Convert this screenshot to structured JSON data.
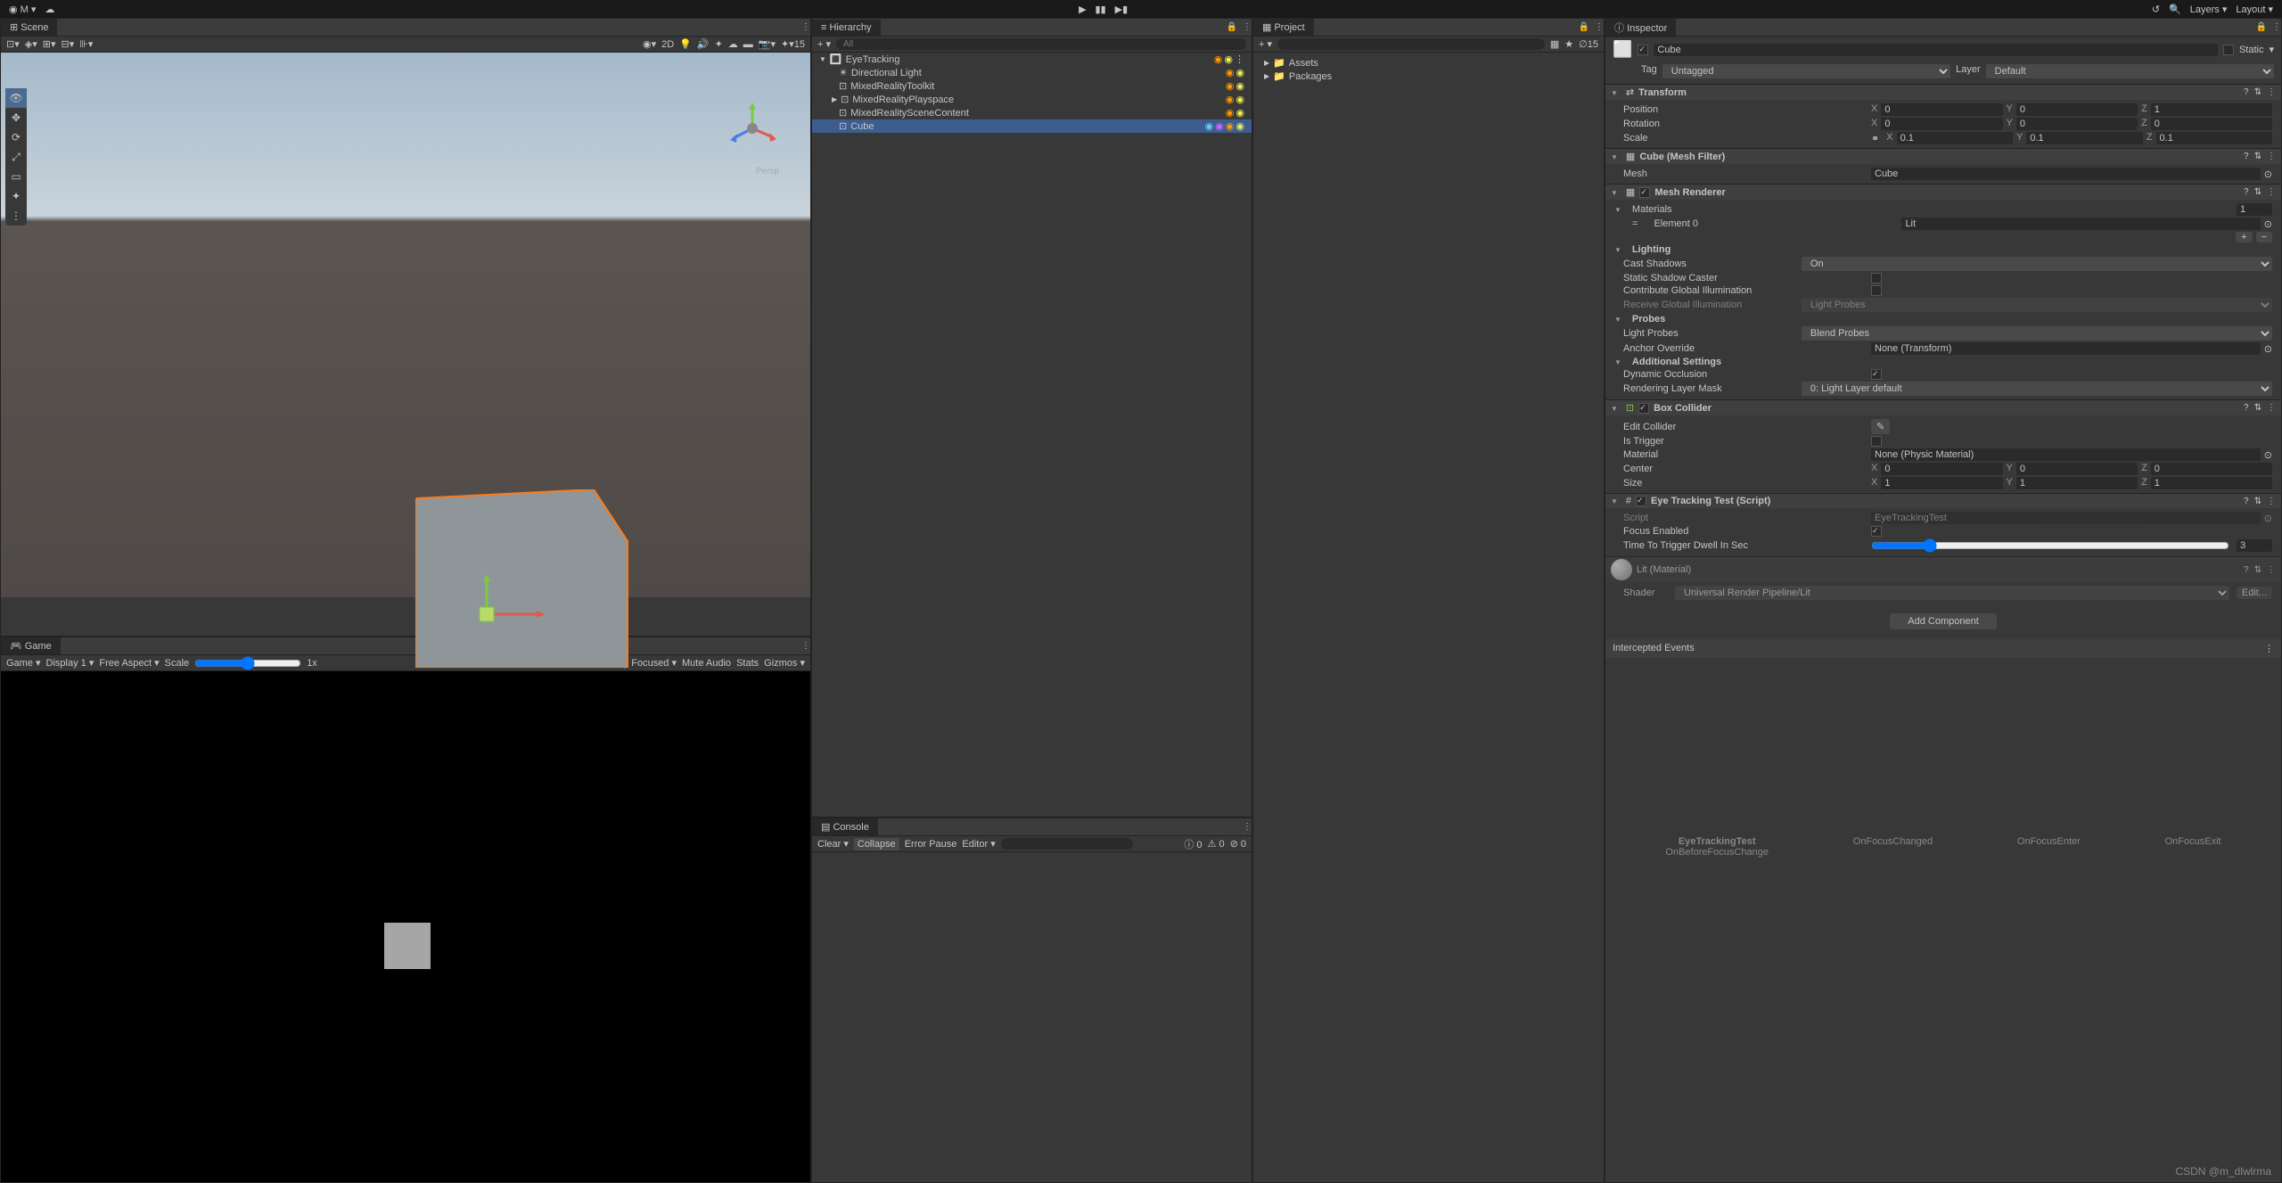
{
  "toolbar": {
    "user": "M",
    "play_icons": [
      "play",
      "pause",
      "step"
    ],
    "layers_label": "Layers",
    "layout_label": "Layout"
  },
  "scene": {
    "tab": "Scene",
    "controls": [
      "2D"
    ],
    "gizmo_count": "15",
    "persp_label": "Persp"
  },
  "game": {
    "tab": "Game",
    "game_label": "Game",
    "display": "Display 1",
    "aspect": "Free Aspect",
    "scale_label": "Scale",
    "scale_value": "1x",
    "play_focused": "Play Focused",
    "mute": "Mute Audio",
    "stats": "Stats",
    "gizmos": "Gizmos"
  },
  "hierarchy": {
    "tab": "Hierarchy",
    "search_ph": "All",
    "scene_name": "EyeTracking",
    "items": [
      {
        "name": "Directional Light",
        "indent": 1
      },
      {
        "name": "MixedRealityToolkit",
        "indent": 1
      },
      {
        "name": "MixedRealityPlayspace",
        "indent": 1
      },
      {
        "name": "MixedRealitySceneContent",
        "indent": 1
      },
      {
        "name": "Cube",
        "indent": 1,
        "selected": true
      }
    ]
  },
  "console": {
    "tab": "Console",
    "clear": "Clear",
    "collapse": "Collapse",
    "error_pause": "Error Pause",
    "editor": "Editor",
    "counts": {
      "info": "0",
      "warn": "0",
      "error": "0"
    }
  },
  "project": {
    "tab": "Project",
    "assets": "Assets",
    "packages": "Packages"
  },
  "inspector": {
    "tab": "Inspector",
    "obj_name": "Cube",
    "static_label": "Static",
    "tag_label": "Tag",
    "tag_value": "Untagged",
    "layer_label": "Layer",
    "layer_value": "Default",
    "transform": {
      "title": "Transform",
      "pos": {
        "label": "Position",
        "x": "0",
        "y": "0",
        "z": "1"
      },
      "rot": {
        "label": "Rotation",
        "x": "0",
        "y": "0",
        "z": "0"
      },
      "scale": {
        "label": "Scale",
        "x": "0.1",
        "y": "0.1",
        "z": "0.1"
      }
    },
    "meshfilter": {
      "title": "Cube (Mesh Filter)",
      "mesh_label": "Mesh",
      "mesh_value": "Cube"
    },
    "meshrenderer": {
      "title": "Mesh Renderer",
      "materials": "Materials",
      "mat_count": "1",
      "element0": "Element 0",
      "element0_val": "Lit",
      "lighting": "Lighting",
      "cast_shadows": "Cast Shadows",
      "cast_shadows_val": "On",
      "static_caster": "Static Shadow Caster",
      "contribute_gi": "Contribute Global Illumination",
      "receive_gi": "Receive Global Illumination",
      "receive_gi_val": "Light Probes",
      "probes": "Probes",
      "light_probes": "Light Probes",
      "light_probes_val": "Blend Probes",
      "anchor": "Anchor Override",
      "anchor_val": "None (Transform)",
      "additional": "Additional Settings",
      "dyn_occ": "Dynamic Occlusion",
      "render_mask": "Rendering Layer Mask",
      "render_mask_val": "0: Light Layer default"
    },
    "boxcollider": {
      "title": "Box Collider",
      "edit": "Edit Collider",
      "trigger": "Is Trigger",
      "material": "Material",
      "material_val": "None (Physic Material)",
      "center": "Center",
      "center_v": {
        "x": "0",
        "y": "0",
        "z": "0"
      },
      "size": "Size",
      "size_v": {
        "x": "1",
        "y": "1",
        "z": "1"
      }
    },
    "eyetracking": {
      "title": "Eye Tracking Test (Script)",
      "script": "Script",
      "script_val": "EyeTrackingTest",
      "focus": "Focus Enabled",
      "dwell": "Time To Trigger Dwell In Sec",
      "dwell_val": "3"
    },
    "material": {
      "title": "Lit (Material)",
      "shader_label": "Shader",
      "shader_val": "Universal Render Pipeline/Lit",
      "edit_btn": "Edit..."
    },
    "add_component": "Add Component",
    "intercepted": "Intercepted Events",
    "events": {
      "title": "EyeTrackingTest",
      "e1": "OnBeforeFocusChange",
      "e2": "OnFocusChanged",
      "e3": "OnFocusEnter",
      "e4": "OnFocusExit"
    }
  },
  "watermark": "CSDN @m_dlwlrma"
}
